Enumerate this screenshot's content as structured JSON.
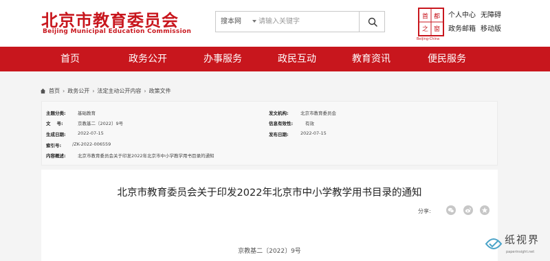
{
  "header": {
    "title": "北京市教育委员会",
    "subtitle": "Beijing Municipal Education Commission"
  },
  "search": {
    "scope": "搜本网",
    "placeholder": "请输入关键字"
  },
  "emblem": {
    "chars": [
      "首",
      "都",
      "之",
      "窗"
    ],
    "caption": "Beijing-China"
  },
  "top_links": [
    "个人中心",
    "无障碍",
    "政务邮箱",
    "移动版"
  ],
  "nav": [
    "首页",
    "政务公开",
    "办事服务",
    "政民互动",
    "教育资讯",
    "便民服务"
  ],
  "breadcrumb": [
    "首页",
    "政务公开",
    "法定主动公开内容",
    "政策文件"
  ],
  "meta": {
    "rows": [
      {
        "label": "主题分类:",
        "value": "基础教育"
      },
      {
        "label": "文    号:",
        "value": "京教基二〔2022〕9号"
      },
      {
        "label": "生成日期:",
        "value": "2022-07-15"
      },
      {
        "label": "索引号:",
        "value": "/ZK-2022-006559"
      },
      {
        "label": "内容概述:",
        "value": "北京市教育委员会关于印发2022年北京市中小学教学用书目录的通知"
      }
    ],
    "right_rows": [
      {
        "label": "发文机构:",
        "value": "北京市教育委员会"
      },
      {
        "label": "信息有效性:",
        "value": "有效"
      },
      {
        "label": "发布日期:",
        "value": "2022-07-15"
      }
    ]
  },
  "document": {
    "title": "北京市教育委员会关于印发2022年北京市中小学教学用书目录的通知",
    "share_label": "分享:",
    "share_icons": [
      "wechat-icon",
      "weibo-icon",
      "star-icon"
    ],
    "number": "京教基二〔2022〕9号"
  },
  "watermark": {
    "title": "纸视界",
    "url": "paperinsight.net"
  },
  "colors": {
    "brand_red": "#c8161d"
  }
}
